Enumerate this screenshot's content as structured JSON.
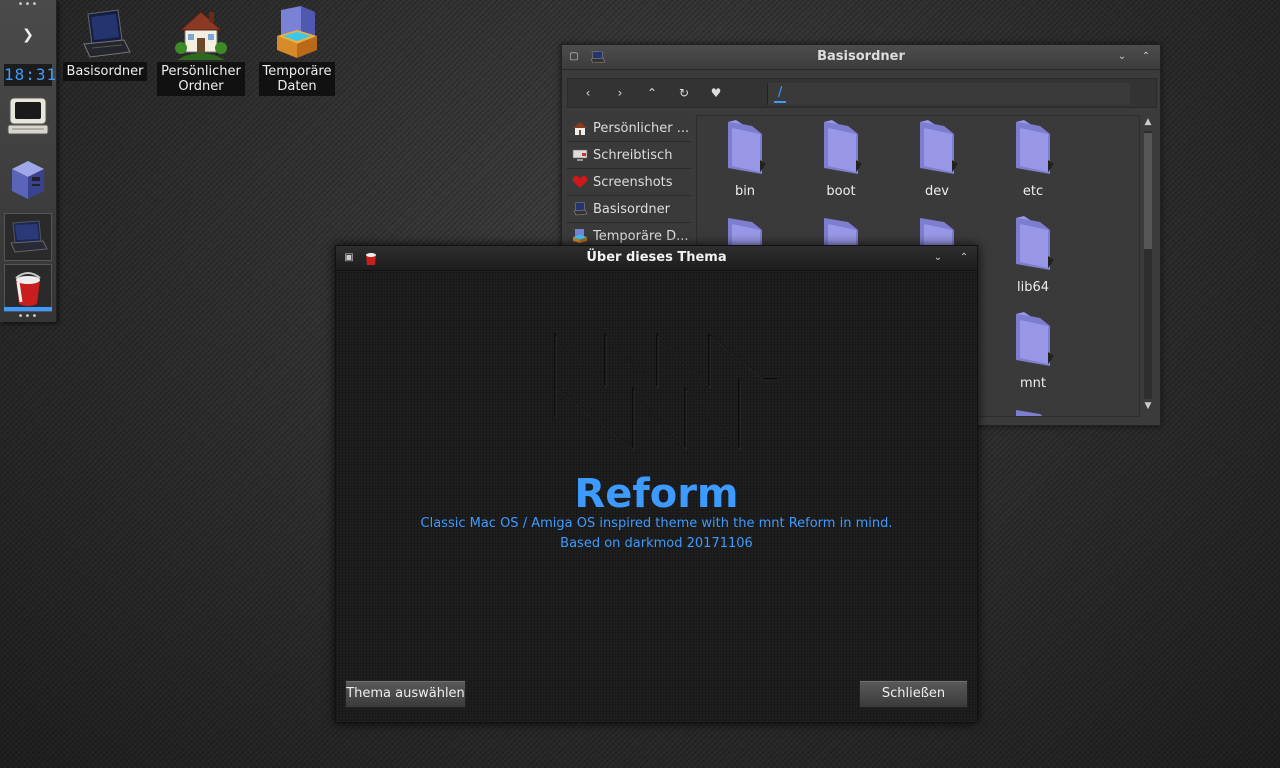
{
  "shelf": {
    "clock": "18:31"
  },
  "desktop_icons": [
    {
      "label": "Basisordner",
      "icon": "laptop-icon"
    },
    {
      "label_line1": "Persönlicher",
      "label_line2": "Ordner",
      "icon": "home-icon"
    },
    {
      "label_line1": "Temporäre",
      "label_line2": "Daten",
      "icon": "temp-box-icon"
    }
  ],
  "file_manager": {
    "title": "Basisordner",
    "path": "/",
    "sidebar": [
      {
        "label": "Persönlicher ...",
        "icon": "home-icon"
      },
      {
        "label": "Schreibtisch",
        "icon": "desktop-icon"
      },
      {
        "label": "Screenshots",
        "icon": "heart-icon"
      },
      {
        "label": "Basisordner",
        "icon": "laptop-icon"
      },
      {
        "label": "Temporäre D...",
        "icon": "temp-box-icon"
      }
    ],
    "folders": [
      "bin",
      "boot",
      "dev",
      "etc",
      "lib64",
      "mnt"
    ]
  },
  "about_dialog": {
    "title": "Über dieses Thema",
    "theme_name": "Reform",
    "description": "Classic Mac OS / Amiga OS inspired theme with the mnt Reform in mind.",
    "based_on": "Based on darkmod 20171106",
    "select_button": "Thema auswählen",
    "close_button": "Schließen"
  },
  "colors": {
    "accent": "#3d9bff",
    "folder": "#8e8ee0"
  }
}
